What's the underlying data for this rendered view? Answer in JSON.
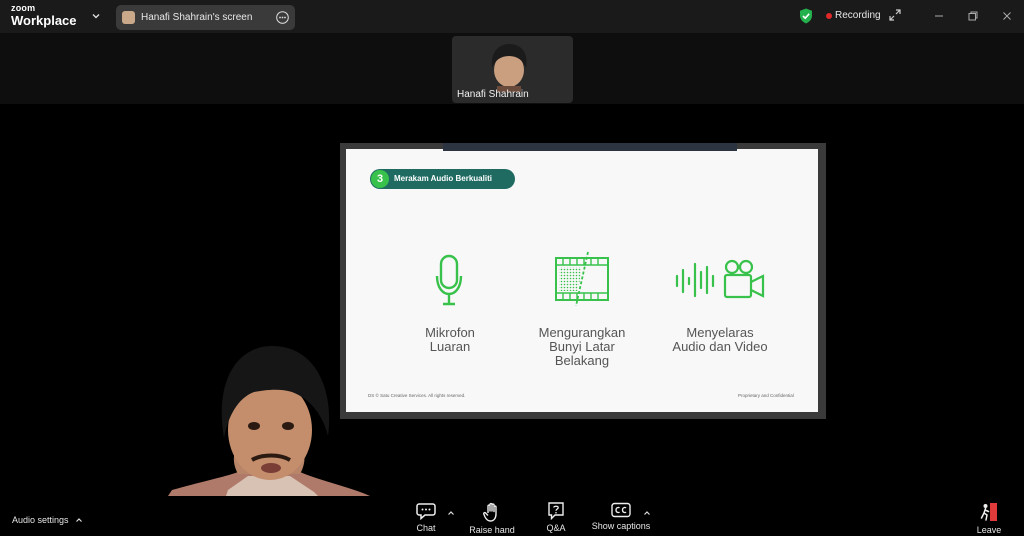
{
  "app": {
    "brand_top": "zoom",
    "brand_name": "Workplace"
  },
  "share": {
    "label": "Hanafi Shahrain's screen"
  },
  "recording": {
    "label": "Recording"
  },
  "participant": {
    "name": "Hanafi Shahrain"
  },
  "slide": {
    "step_number": "3",
    "heading": "Merakam Audio Berkualiti",
    "features": [
      {
        "line1": "Mikrofon",
        "line2": "Luaran",
        "line3": ""
      },
      {
        "line1": "Mengurangkan",
        "line2": "Bunyi Latar",
        "line3": "Belakang"
      },
      {
        "line1": "Menyelaras",
        "line2": "Audio dan Video",
        "line3": ""
      }
    ],
    "footer_left": "DS © Satu Creative Services. All rights reserved.",
    "footer_right": "Proprietary and Confidential",
    "accent_color": "#38c24b",
    "pill_color": "#1f6b62"
  },
  "toolbar": {
    "audio_settings": "Audio settings",
    "chat": "Chat",
    "raise_hand": "Raise hand",
    "qa": "Q&A",
    "captions": "Show captions",
    "leave": "Leave"
  },
  "icons": [
    "chevron-down-icon",
    "more-icon",
    "shield-check-icon",
    "expand-icon",
    "minimize-icon",
    "restore-icon",
    "close-icon",
    "chat-icon",
    "hand-icon",
    "question-icon",
    "cc-icon",
    "leave-icon"
  ]
}
